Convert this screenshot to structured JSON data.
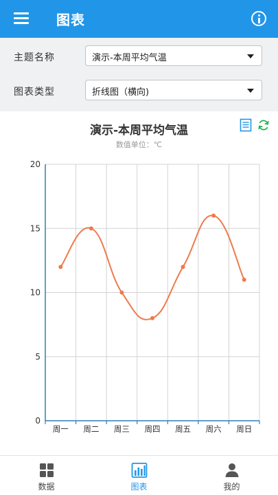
{
  "topbar": {
    "title": "图表",
    "menu_icon": "hamburger-menu-icon",
    "info_icon": "info-circle-icon"
  },
  "form": {
    "topic_label": "主题名称",
    "topic_value": "演示-本周平均气温",
    "type_label": "图表类型",
    "type_value": "折线图（横向)"
  },
  "chart_data": {
    "type": "line",
    "title": "演示-本周平均气温",
    "subtitle": "数值单位：℃",
    "categories": [
      "周一",
      "周二",
      "周三",
      "周四",
      "周五",
      "周六",
      "周日"
    ],
    "series": [
      {
        "values": [
          12,
          15,
          10,
          8,
          12,
          16,
          11
        ]
      }
    ],
    "ylim": [
      0,
      20
    ],
    "yticks": [
      "0",
      "5",
      "10",
      "15",
      "20"
    ],
    "grid": true,
    "smooth": true,
    "line_color": "#ef7a4b"
  },
  "tools": {
    "data_view_icon": "document-list-icon",
    "refresh_icon": "refresh-icon"
  },
  "bottomnav": {
    "items": [
      {
        "label": "数据",
        "icon": "grid-icon"
      },
      {
        "label": "图表",
        "icon": "bar-chart-icon"
      },
      {
        "label": "我的",
        "icon": "person-icon"
      }
    ]
  },
  "colors": {
    "primary": "#2196e8",
    "line": "#ef7a4b",
    "axis": "#2f7fb8",
    "grid": "#d3d3d3"
  }
}
